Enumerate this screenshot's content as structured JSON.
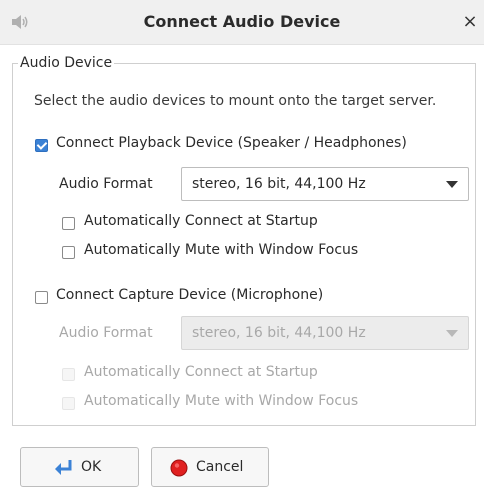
{
  "window": {
    "title": "Connect Audio Device",
    "close_glyph": "×",
    "icon": "speaker-icon"
  },
  "group": {
    "legend": "Audio Device",
    "description": "Select the audio devices to mount onto the target server."
  },
  "playback": {
    "label": "Connect Playback Device (Speaker / Headphones)",
    "checked": true,
    "format_label": "Audio Format",
    "format_value": "stereo, 16 bit, 44,100 Hz",
    "auto_connect_label": "Automatically Connect at Startup",
    "auto_connect_checked": false,
    "auto_mute_label": "Automatically Mute with Window Focus",
    "auto_mute_checked": false
  },
  "capture": {
    "label": "Connect Capture Device (Microphone)",
    "checked": false,
    "format_label": "Audio Format",
    "format_value": "stereo, 16 bit, 44,100 Hz",
    "auto_connect_label": "Automatically Connect at Startup",
    "auto_mute_label": "Automatically Mute with Window Focus",
    "disabled": true
  },
  "buttons": {
    "ok_label": "OK",
    "ok_icon": "enter-arrow-icon",
    "cancel_label": "Cancel",
    "cancel_icon": "red-stop-icon"
  },
  "colors": {
    "accent": "#3b82d6",
    "disabled_text": "#a8a8a8",
    "cancel_red": "#e02020"
  }
}
